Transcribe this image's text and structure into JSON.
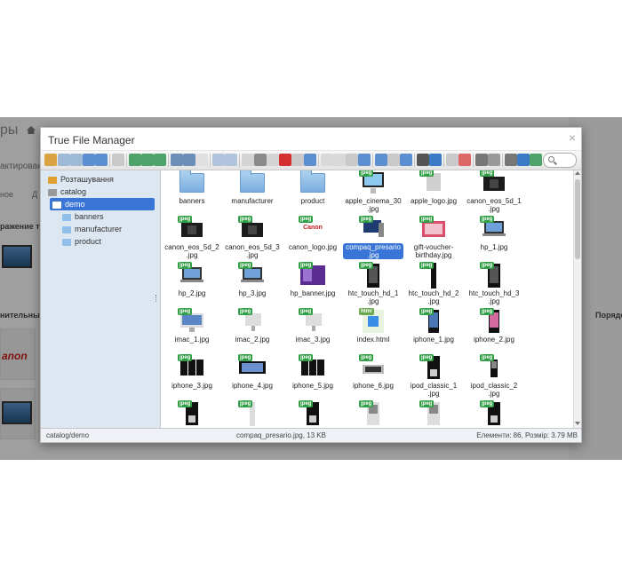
{
  "background_page": {
    "title": "ры",
    "edit_label": "актирован",
    "sub_label_1": "ное",
    "sub_label_2": "Д",
    "image_label": "ражение тов",
    "extra_label": "нительные",
    "right_label": "Порядо",
    "brand_text": "anon"
  },
  "modal": {
    "title": "True File Manager",
    "close": "×"
  },
  "toolbar": {
    "search_placeholder": ""
  },
  "sidebar": {
    "items": [
      {
        "label": "Розташування",
        "level": 0,
        "icon": "places-icon"
      },
      {
        "label": "catalog",
        "level": 1,
        "icon": "drive-icon"
      },
      {
        "label": "demo",
        "level": 2,
        "icon": "folder-icon",
        "selected": true
      },
      {
        "label": "banners",
        "level": 3,
        "icon": "folder-icon"
      },
      {
        "label": "manufacturer",
        "level": 3,
        "icon": "folder-icon"
      },
      {
        "label": "product",
        "level": 3,
        "icon": "folder-icon"
      }
    ]
  },
  "files": [
    {
      "name": "banners",
      "kind": "folder"
    },
    {
      "name": "manufacturer",
      "kind": "folder"
    },
    {
      "name": "product",
      "kind": "folder"
    },
    {
      "name": "apple_cinema_30.jpg",
      "display": "apple_cinema_30\n.jpg",
      "kind": "jpeg",
      "pic": "monitor"
    },
    {
      "name": "apple_logo.jpg",
      "kind": "jpeg",
      "pic": "apple"
    },
    {
      "name": "canon_eos_5d_1.jpg",
      "display": "canon_eos_5d_1\n.jpg",
      "kind": "jpeg",
      "pic": "camera"
    },
    {
      "name": "canon_eos_5d_2.jpg",
      "display": "canon_eos_5d_2\n.jpg",
      "kind": "jpeg",
      "pic": "camera"
    },
    {
      "name": "canon_eos_5d_3.jpg",
      "display": "canon_eos_5d_3\n.jpg",
      "kind": "jpeg",
      "pic": "camera"
    },
    {
      "name": "canon_logo.jpg",
      "kind": "jpeg",
      "pic": "canon"
    },
    {
      "name": "compaq_presario.jpg",
      "display": "compaq_presario\n.jpg",
      "kind": "jpeg",
      "pic": "desktop",
      "selected": true
    },
    {
      "name": "gift-voucher-birthday.jpg",
      "display": "gift-voucher-\nbirthday.jpg",
      "kind": "jpeg",
      "pic": "gift"
    },
    {
      "name": "hp_1.jpg",
      "kind": "jpeg",
      "pic": "laptop"
    },
    {
      "name": "hp_2.jpg",
      "kind": "jpeg",
      "pic": "laptop"
    },
    {
      "name": "hp_3.jpg",
      "kind": "jpeg",
      "pic": "laptop"
    },
    {
      "name": "hp_banner.jpg",
      "kind": "jpeg",
      "pic": "banner"
    },
    {
      "name": "htc_touch_hd_1.jpg",
      "display": "htc_touch_hd_1\n.jpg",
      "kind": "jpeg",
      "pic": "phone"
    },
    {
      "name": "htc_touch_hd_2.jpg",
      "display": "htc_touch_hd_2\n.jpg",
      "kind": "jpeg",
      "pic": "phone-side"
    },
    {
      "name": "htc_touch_hd_3.jpg",
      "display": "htc_touch_hd_3\n.jpg",
      "kind": "jpeg",
      "pic": "phone"
    },
    {
      "name": "imac_1.jpg",
      "kind": "jpeg",
      "pic": "imac"
    },
    {
      "name": "imac_2.jpg",
      "kind": "jpeg",
      "pic": "imac-small"
    },
    {
      "name": "imac_3.jpg",
      "kind": "jpeg",
      "pic": "imac-small"
    },
    {
      "name": "index.html",
      "kind": "html",
      "pic": "html"
    },
    {
      "name": "iphone_1.jpg",
      "kind": "jpeg",
      "pic": "iphone"
    },
    {
      "name": "iphone_2.jpg",
      "kind": "jpeg",
      "pic": "iphone-pink"
    },
    {
      "name": "iphone_3.jpg",
      "kind": "jpeg",
      "pic": "iphones"
    },
    {
      "name": "iphone_4.jpg",
      "kind": "jpeg",
      "pic": "iphone-wide"
    },
    {
      "name": "iphone_5.jpg",
      "kind": "jpeg",
      "pic": "iphones"
    },
    {
      "name": "iphone_6.jpg",
      "kind": "jpeg",
      "pic": "iphone-flat"
    },
    {
      "name": "ipod_classic_1.jpg",
      "display": "ipod_classic_1\n.jpg",
      "kind": "jpeg",
      "pic": "ipod"
    },
    {
      "name": "ipod_classic_2.jpg",
      "display": "ipod_classic_2\n.jpg",
      "kind": "jpeg",
      "pic": "ipod-small"
    },
    {
      "name": "",
      "kind": "jpeg",
      "pic": "ipod"
    },
    {
      "name": "",
      "kind": "jpeg",
      "pic": "ipod-thin"
    },
    {
      "name": "",
      "kind": "jpeg",
      "pic": "ipod"
    },
    {
      "name": "",
      "kind": "jpeg",
      "pic": "ipod-silver"
    },
    {
      "name": "",
      "kind": "jpeg",
      "pic": "ipod-silver"
    },
    {
      "name": "",
      "kind": "jpeg",
      "pic": "ipod"
    }
  ],
  "badges": {
    "jpeg": "jpeg",
    "html": "html"
  },
  "status": {
    "path": "catalog/demo",
    "file": "compaq_presario.jpg, 13 KB",
    "info": "Елементи: 86, Розмір: 3.79 MB"
  },
  "colors": {
    "accent": "#3875d7",
    "sidebar_bg": "#dde7f2",
    "jpeg_badge": "#2f9e44"
  }
}
